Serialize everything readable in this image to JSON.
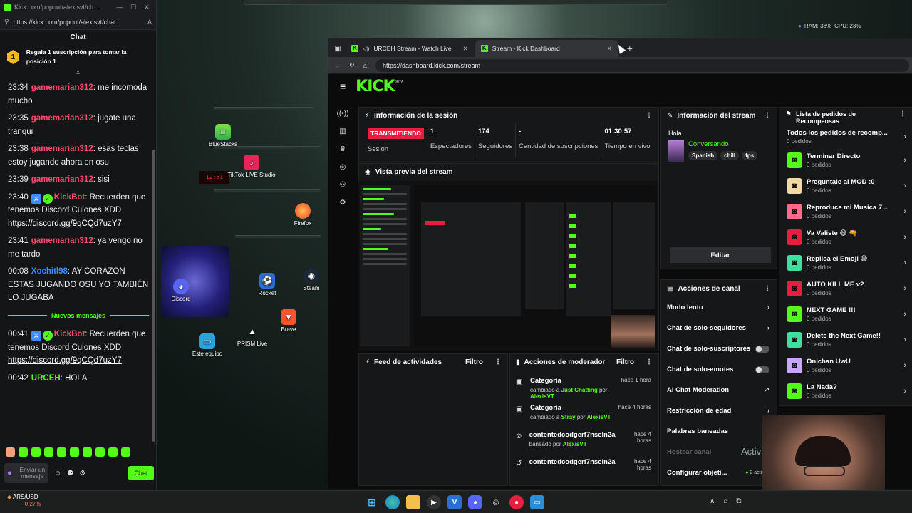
{
  "chat_window": {
    "title": "Kick.com/popout/alexisvt/ch...",
    "url": "https://kick.com/popout/alexisvt/chat",
    "header": "Chat",
    "pinned_text": "Regala 1 suscripción para tomar la posición 1",
    "pinned_rank": "1",
    "messages": [
      {
        "ts": "23:34",
        "user": "gamemarian312",
        "color": "#ff4a6e",
        "text": "me incomoda mucho"
      },
      {
        "ts": "23:35",
        "user": "gamemarian312",
        "color": "#ff4a6e",
        "text": "jugate una tranqui"
      },
      {
        "ts": "23:38",
        "user": "gamemarian312",
        "color": "#ff4a6e",
        "text": "esas teclas estoy jugando ahora en osu"
      },
      {
        "ts": "23:39",
        "user": "gamemarian312",
        "color": "#ff4a6e",
        "text": "sisi"
      },
      {
        "ts": "23:40",
        "user": "KickBot",
        "color": "#ff4a6e",
        "text": "Recuerden que tenemos Discord Culones XDD",
        "link": "https://discord.gg/9qCQd7uzY7"
      },
      {
        "ts": "23:41",
        "user": "gamemarian312",
        "color": "#ff4a6e",
        "text": "ya vengo no me tardo"
      },
      {
        "ts": "00:08",
        "user": "Xochitl98",
        "color": "#3f8cff",
        "text": "AY CORAZON ESTAS JUGANDO OSU YO TAMBIÉN LO JUGABA"
      }
    ],
    "new_messages_label": "Nuevos mensajes",
    "messages_after": [
      {
        "ts": "00:41",
        "user": "KickBot",
        "color": "#ff4a6e",
        "text": "Recuerden que tenemos Discord Culones XDD",
        "link": "https://discord.gg/9qCQd7uzY7"
      },
      {
        "ts": "00:42",
        "user": "URCEH",
        "color": "#53fc18",
        "text": "HOLA"
      }
    ],
    "input_placeholder": "Enviar un mensaje",
    "send_label": "Chat"
  },
  "desktop_icons": {
    "bluestacks": "BlueStacks",
    "tiktok": "TikTok LIVE Studio",
    "firefox": "Firefox",
    "discord": "Discord",
    "rocket": "Rocket",
    "steam": "Steam",
    "brave": "Brave",
    "prism": "PRISM Live",
    "pc": "Este equipo"
  },
  "system_monitor": {
    "ram": "RAM: 38%",
    "cpu": "CPU: 23%"
  },
  "browser": {
    "tabs": [
      {
        "label": "URCEH Stream - Watch Live",
        "active": false
      },
      {
        "label": "Stream - Kick Dashboard",
        "active": true
      }
    ],
    "url": "https://dashboard.kick.com/stream"
  },
  "dashboard": {
    "logo": "KICK",
    "logo_badge": "BETA",
    "session": {
      "title": "Información de la sesión",
      "live_badge": "TRANSMITIENDO",
      "session_label": "Sesión",
      "stats": [
        {
          "value": "1",
          "label": "Espectadores"
        },
        {
          "value": "174",
          "label": "Seguidores"
        },
        {
          "value": "-",
          "label": "Cantidad de suscripciones"
        },
        {
          "value": "01:30:57",
          "label": "Tiempo en vivo"
        }
      ]
    },
    "preview_title": "Vista previa del stream",
    "stream_info": {
      "title": "Información del stream",
      "stream_title": "Hola",
      "category": "Conversando",
      "tags": [
        "Spanish",
        "chill",
        "fps"
      ],
      "edit_label": "Editar"
    },
    "channel_actions": {
      "title": "Acciones de canal",
      "items": [
        {
          "label": "Modo lento",
          "kind": "arrow"
        },
        {
          "label": "Chat de solo-seguidores",
          "kind": "arrow"
        },
        {
          "label": "Chat de solo-suscriptores",
          "kind": "toggle"
        },
        {
          "label": "Chat de solo-emotes",
          "kind": "toggle"
        },
        {
          "label": "AI Chat Moderation",
          "kind": "external"
        },
        {
          "label": "Restricción de edad",
          "kind": "arrow"
        },
        {
          "label": "Palabras baneadas",
          "kind": "none"
        },
        {
          "label": "Hostear canal",
          "kind": "dim"
        },
        {
          "label": "Configurar objeti...",
          "kind": "badge",
          "badge": "2 activas"
        }
      ]
    },
    "rewards": {
      "title": "Lista de pedidos de Recompensas",
      "all_label": "Todos los pedidos de recomp...",
      "all_count": "0 pedidos",
      "items": [
        {
          "name": "Terminar Directo",
          "count": "0 pedidos",
          "color": "#53fc18"
        },
        {
          "name": "Preguntale al MOD :0",
          "count": "0 pedidos",
          "color": "#f3d9a4"
        },
        {
          "name": "Reproduce mi Musica 7...",
          "count": "0 pedidos",
          "color": "#ff6a8a"
        },
        {
          "name": "Va Valiste 😅 🔫",
          "count": "0 pedidos",
          "color": "#e91e3f"
        },
        {
          "name": "Replica el Emoji 😄",
          "count": "0 pedidos",
          "color": "#3ee0a0"
        },
        {
          "name": "AUTO KILL ME v2",
          "count": "0 pedidos",
          "color": "#e91e3f"
        },
        {
          "name": "NEXT GAME !!!",
          "count": "0 pedidos",
          "color": "#53fc18"
        },
        {
          "name": "Delete the Next Game!!",
          "count": "0 pedidos",
          "color": "#3ee0a0"
        },
        {
          "name": "Onichan UwU",
          "count": "0 pedidos",
          "color": "#c9a6ff"
        },
        {
          "name": "La Nada?",
          "count": "0 pedidos",
          "color": "#53fc18"
        }
      ]
    },
    "activity_feed": {
      "title": "Feed de actividades",
      "filter": "Filtro"
    },
    "mod_actions": {
      "title": "Acciones de moderador",
      "filter": "Filtro",
      "items": [
        {
          "title": "Categoría",
          "pre": "cambiado a",
          "target": "Just Chatting",
          "mid": "por",
          "by": "AlexisVT",
          "time": "hace 1 hora"
        },
        {
          "title": "Categoría",
          "pre": "cambiado a",
          "target": "Stray",
          "mid": "por",
          "by": "AlexisVT",
          "time": "hace 4 horas"
        },
        {
          "title": "contentedcodgerf7nseln2a",
          "pre": "baneado por",
          "target": "AlexisVT",
          "mid": "",
          "by": "",
          "time": "hace 4 horas"
        },
        {
          "title": "contentedcodgerf7nseln2a",
          "pre": "",
          "target": "",
          "mid": "",
          "by": "",
          "time": "hace 4 horas"
        }
      ]
    }
  },
  "overlay_text": "Activ",
  "taskbar": {
    "ticker_pair": "ARS/USD",
    "ticker_change": "-0,27%"
  }
}
